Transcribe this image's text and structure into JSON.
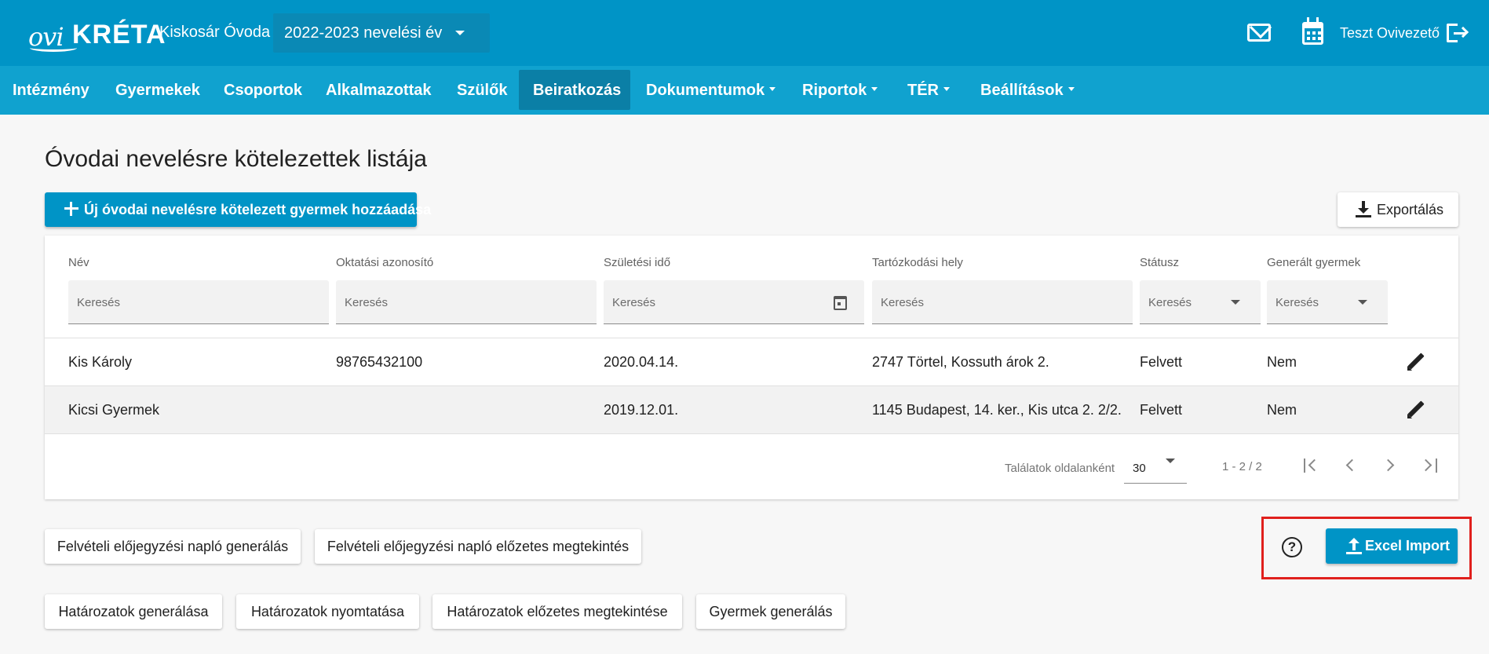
{
  "header": {
    "logo_text_left": "ovi",
    "logo_text_right": "KRÉTA",
    "institution": "Kiskosár Óvoda",
    "year_select": "2022-2023 nevelési év",
    "user": "Teszt Ovivezető",
    "icons": [
      "mail-icon",
      "calendar-icon",
      "logout-icon"
    ]
  },
  "nav": {
    "items": [
      {
        "label": "Intézmény"
      },
      {
        "label": "Gyermekek"
      },
      {
        "label": "Csoportok"
      },
      {
        "label": "Alkalmazottak"
      },
      {
        "label": "Szülők"
      },
      {
        "label": "Beiratkozás",
        "active": true
      },
      {
        "label": "Dokumentumok"
      },
      {
        "label": "Riportok"
      },
      {
        "label": "TÉR"
      },
      {
        "label": "Beállítások"
      }
    ]
  },
  "page": {
    "title": "Óvodai nevelésre kötelezettek listája",
    "add_button": "Új óvodai nevelésre kötelezett gyermek hozzáadása",
    "export_button": "Exportálás"
  },
  "table": {
    "columns": [
      "Név",
      "Oktatási azonosító",
      "Születési idő",
      "Tartózkodási hely",
      "Státusz",
      "Generált gyermek"
    ],
    "filter_placeholder": "Keresés",
    "rows": [
      [
        "Kis Károly",
        "98765432100",
        "2020.04.14.",
        "2747 Törtel, Kossuth árok 2.",
        "Felvett",
        "Nem"
      ],
      [
        "Kicsi Gyermek",
        "",
        "2019.12.01.",
        "1145 Budapest, 14. ker., Kis utca 2. 2/2.",
        "Felvett",
        "Nem"
      ]
    ],
    "pager": {
      "label": "Találatok oldalanként",
      "page_size": "30",
      "range": "1 - 2 / 2"
    }
  },
  "actions": {
    "row1": [
      "Felvételi előjegyzési napló generálás",
      "Felvételi előjegyzési napló előzetes megtekintés"
    ],
    "row2": [
      "Határozatok generálása",
      "Határozatok nyomtatása",
      "Határozatok előzetes megtekintése",
      "Gyermek generálás"
    ],
    "help": "?",
    "excel_import": "Excel Import"
  },
  "colors": {
    "header_bg": "#0094c6",
    "nav_bg": "#10a2cf",
    "nav_active": "#0b7fa6",
    "primary": "#0094c6",
    "highlight": "#e0201d"
  }
}
